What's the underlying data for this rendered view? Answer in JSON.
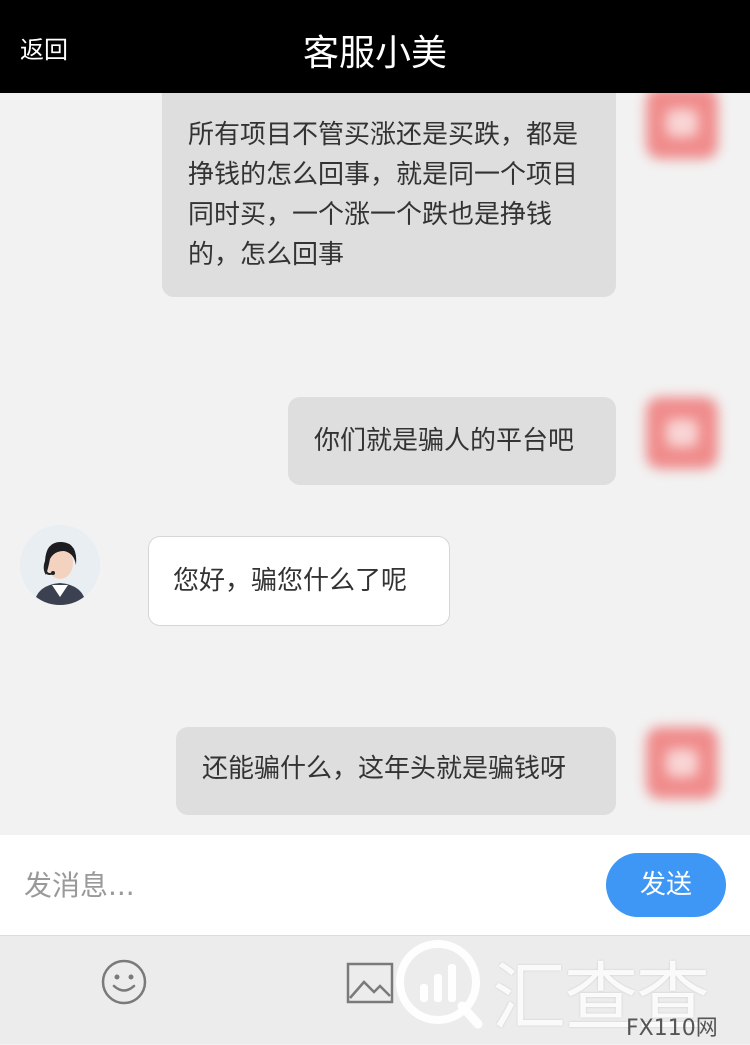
{
  "header": {
    "back_label": "返回",
    "title": "客服小美"
  },
  "messages": [
    {
      "sender": "user",
      "text": "所有项目不管买涨还是买跌，都是挣钱的怎么回事，就是同一个项目同时买，一个涨一个跌也是挣钱的，怎么回事"
    },
    {
      "sender": "user",
      "text": "你们就是骗人的平台吧"
    },
    {
      "sender": "agent",
      "text": "您好，骗您什么了呢"
    },
    {
      "sender": "user",
      "text": "还能骗什么，这年头就是骗钱呀"
    }
  ],
  "input": {
    "placeholder": "发消息..."
  },
  "send_label": "发送",
  "toolbar": {
    "icons": [
      "smiley-icon",
      "image-icon"
    ]
  },
  "watermark": {
    "text": "汇查查",
    "code": "FX110网"
  },
  "colors": {
    "header_bg": "#000000",
    "send_button": "#3e97f5",
    "user_bubble": "#dedede",
    "agent_bubble": "#ffffff",
    "chat_bg": "#f2f2f2"
  }
}
